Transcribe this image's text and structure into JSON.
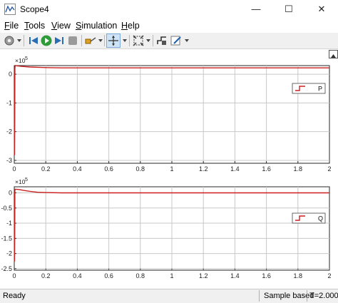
{
  "window": {
    "title": "Scope4",
    "minimize": "—",
    "maximize": "☐",
    "close": "✕"
  },
  "menu": [
    {
      "label": "File",
      "mnemonic": "F",
      "rest": "ile"
    },
    {
      "label": "Tools",
      "mnemonic": "T",
      "rest": "ools"
    },
    {
      "label": "View",
      "mnemonic": "V",
      "rest": "iew"
    },
    {
      "label": "Simulation",
      "mnemonic": "S",
      "rest": "imulation"
    },
    {
      "label": "Help",
      "mnemonic": "H",
      "rest": "elp"
    }
  ],
  "toolbar": [
    "settings-icon",
    "dropdown",
    "rewind-icon",
    "run-icon",
    "step-forward-icon",
    "stop-icon",
    "highlight-icon",
    "dropdown",
    "zoom-icon",
    "dropdown",
    "autoscale-icon",
    "dropdown",
    "triggers-icon",
    "edit-cursor-icon",
    "dropdown"
  ],
  "colors": {
    "signal": "#cc1f1f",
    "grid": "#c8c8c8",
    "axis": "#262626"
  },
  "statusbar": {
    "left": "Ready",
    "mode": "Sample based",
    "time": "T=2.000"
  },
  "chart_data": [
    {
      "type": "line",
      "exponent_label": "×10",
      "exponent": "5",
      "xlim": [
        0,
        2
      ],
      "ylim": [
        -3.1,
        0.3
      ],
      "x_ticks": [
        "0",
        "0.2",
        "0.4",
        "0.6",
        "0.8",
        "1",
        "1.2",
        "1.4",
        "1.6",
        "1.8",
        "2"
      ],
      "y_ticks": [
        {
          "v": 0,
          "label": "0"
        },
        {
          "v": -1,
          "label": "-1"
        },
        {
          "v": -2,
          "label": "-2"
        },
        {
          "v": -3,
          "label": "-3"
        }
      ],
      "grid": true,
      "legend": "top-right",
      "series": [
        {
          "name": "P",
          "x": [
            0,
            0.001,
            0.002,
            0.003,
            0.004,
            0.006,
            0.01,
            0.02,
            0.05,
            0.1,
            0.15,
            0.2,
            0.3,
            0.5,
            1,
            1.5,
            2
          ],
          "y": [
            0,
            -2.8,
            -2.8,
            -1.5,
            0.2,
            0.3,
            0.3,
            0.29,
            0.27,
            0.25,
            0.24,
            0.23,
            0.22,
            0.22,
            0.22,
            0.22,
            0.22
          ]
        }
      ]
    },
    {
      "type": "line",
      "exponent_label": "×10",
      "exponent": "5",
      "xlim": [
        0,
        2
      ],
      "ylim": [
        -2.55,
        0.2
      ],
      "x_ticks": [
        "0",
        "0.2",
        "0.4",
        "0.6",
        "0.8",
        "1",
        "1.2",
        "1.4",
        "1.6",
        "1.8",
        "2"
      ],
      "y_ticks": [
        {
          "v": 0,
          "label": "0"
        },
        {
          "v": -0.5,
          "label": "-0.5"
        },
        {
          "v": -1,
          "label": "-1"
        },
        {
          "v": -1.5,
          "label": "-1.5"
        },
        {
          "v": -2,
          "label": "-2"
        },
        {
          "v": -2.5,
          "label": "-2.5"
        }
      ],
      "grid": true,
      "legend": "top-right",
      "series": [
        {
          "name": "Q",
          "x": [
            0,
            0.001,
            0.002,
            0.003,
            0.004,
            0.006,
            0.01,
            0.03,
            0.06,
            0.1,
            0.15,
            0.2,
            0.3,
            0.5,
            1,
            1.5,
            2
          ],
          "y": [
            0,
            -2.25,
            -2.25,
            -1.2,
            0.08,
            0.12,
            0.12,
            0.11,
            0.08,
            0.05,
            0.02,
            0.01,
            0.0,
            0.0,
            0.0,
            0.0,
            0.0
          ]
        }
      ]
    }
  ]
}
